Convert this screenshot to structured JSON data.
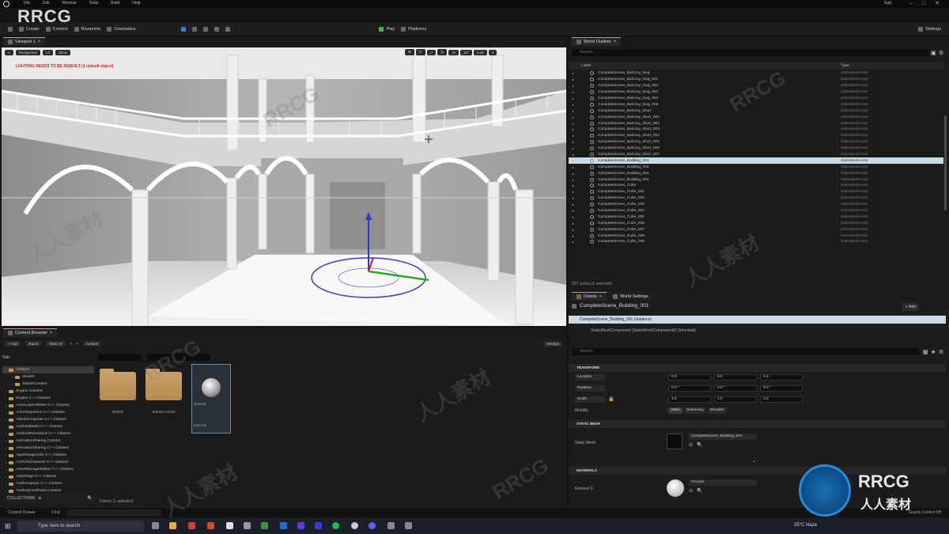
{
  "menu": {
    "items": [
      "File",
      "Edit",
      "Window",
      "Tools",
      "Build",
      "Help"
    ],
    "project": "Sad"
  },
  "watermark": {
    "top_left": "RRCG",
    "logo_main": "RRCG",
    "logo_sub": "人人素材",
    "diag_cn": "人人素材",
    "diag_en": "RRCG"
  },
  "toolbar": {
    "save": "",
    "mode": "Create",
    "content": "Content",
    "blueprints": "Blueprints",
    "cinematics": "Cinematics",
    "play": "Play",
    "platforms": "Platforms",
    "settings": "Settings"
  },
  "viewport": {
    "tab": "Viewport 1",
    "perspective": "Perspective",
    "lit": "Lit",
    "show": "Show",
    "warning": "LIGHTING NEEDS TO BE REBUILT (1 unbuilt object)",
    "icons": [
      "10",
      "10°",
      "0.25",
      "4"
    ]
  },
  "outliner": {
    "tab": "World Outliner",
    "search_placeholder": "Search...",
    "col_label": "Label",
    "col_type": "Type",
    "rows": [
      {
        "name": "CompleteScene_Balcony_long",
        "type": "StaticMeshActor"
      },
      {
        "name": "CompleteScene_Balcony_long_001",
        "type": "StaticMeshActor"
      },
      {
        "name": "CompleteScene_Balcony_long_002",
        "type": "StaticMeshActor"
      },
      {
        "name": "CompleteScene_Balcony_long_003",
        "type": "StaticMeshActor"
      },
      {
        "name": "CompleteScene_Balcony_long_004",
        "type": "StaticMeshActor"
      },
      {
        "name": "CompleteScene_Balcony_long_005",
        "type": "StaticMeshActor"
      },
      {
        "name": "CompleteScene_Balcony_short",
        "type": "StaticMeshActor"
      },
      {
        "name": "CompleteScene_Balcony_short_001",
        "type": "StaticMeshActor"
      },
      {
        "name": "CompleteScene_Balcony_short_002",
        "type": "StaticMeshActor"
      },
      {
        "name": "CompleteScene_Balcony_short_003",
        "type": "StaticMeshActor"
      },
      {
        "name": "CompleteScene_Balcony_short_004",
        "type": "StaticMeshActor"
      },
      {
        "name": "CompleteScene_Balcony_short_005",
        "type": "StaticMeshActor"
      },
      {
        "name": "CompleteScene_Balcony_short_006",
        "type": "StaticMeshActor"
      },
      {
        "name": "CompleteScene_Balcony_short_007",
        "type": "StaticMeshActor"
      },
      {
        "name": "CompleteScene_Building_001",
        "type": "StaticMeshActor",
        "selected": true
      },
      {
        "name": "CompleteScene_Building_002",
        "type": "StaticMeshActor"
      },
      {
        "name": "CompleteScene_Building_003",
        "type": "StaticMeshActor"
      },
      {
        "name": "CompleteScene_Building_004",
        "type": "StaticMeshActor"
      },
      {
        "name": "CompleteScene_Cube",
        "type": "StaticMeshActor"
      },
      {
        "name": "CompleteScene_Cube_001",
        "type": "StaticMeshActor"
      },
      {
        "name": "CompleteScene_Cube_002",
        "type": "StaticMeshActor"
      },
      {
        "name": "CompleteScene_Cube_003",
        "type": "StaticMeshActor"
      },
      {
        "name": "CompleteScene_Cube_004",
        "type": "StaticMeshActor"
      },
      {
        "name": "CompleteScene_Cube_005",
        "type": "StaticMeshActor"
      },
      {
        "name": "CompleteScene_Cube_006",
        "type": "StaticMeshActor"
      },
      {
        "name": "CompleteScene_Cube_007",
        "type": "StaticMeshActor"
      },
      {
        "name": "CompleteScene_Cube_008",
        "type": "StaticMeshActor"
      },
      {
        "name": "CompleteScene_Cube_009",
        "type": "StaticMeshActor"
      }
    ],
    "status": "157 actors (1 selected)"
  },
  "details": {
    "tab": "Details",
    "tab2": "World Settings",
    "object_name": "CompleteScene_Building_001",
    "add_label": "+ Add",
    "instance_row": "CompleteScene_Building_001 (Instance)",
    "component_row": "StaticMeshComponent (StaticMeshComponent0) (Inherited)",
    "search_placeholder": "Search",
    "transform_header": "TRANSFORM",
    "location_label": "Location",
    "rotation_label": "Rotation",
    "scale_label": "Scale",
    "location": [
      "0.0",
      "0.0",
      "0.0"
    ],
    "rotation": [
      "0.0 °",
      "0.0 °",
      "0.0 °"
    ],
    "scale": [
      "1.0",
      "1.0",
      "1.0"
    ],
    "mobility_label": "Mobility",
    "mobility": [
      "Static",
      "Stationary",
      "Movable"
    ],
    "static_mesh_header": "STATIC MESH",
    "static_mesh_label": "Static Mesh",
    "static_mesh_value": "CompleteScene_Building_001",
    "materials_header": "MATERIALS",
    "element_label": "Element 0",
    "material_value": "Ground"
  },
  "content_browser": {
    "tab": "Content Browser",
    "add": "+ Add",
    "import": "Import",
    "save_all": "Save All",
    "path": "Content",
    "settings": "Settings",
    "tree_header": "Sub",
    "tree": [
      {
        "label": "Content",
        "selected": true
      },
      {
        "label": "Models"
      },
      {
        "label": "StarterContent"
      },
      {
        "label": "Engine Content"
      },
      {
        "label": "Engine C++ Classes"
      },
      {
        "label": "ActorLayerUtilities C++ Classes"
      },
      {
        "label": "ActorSequence C++ Classes"
      },
      {
        "label": "AlembicImporter C++ Classes"
      },
      {
        "label": "AndroidMedia C++ Classes"
      },
      {
        "label": "AndroidPermission C++ Classes"
      },
      {
        "label": "AnimationSharing Content"
      },
      {
        "label": "AnimationSharing C++ Classes"
      },
      {
        "label": "AppleImageUtils C++ Classes"
      },
      {
        "label": "ArchVisCharacter C++ Classes"
      },
      {
        "label": "AssetManagerEditor C++ Classes"
      },
      {
        "label": "AssetTags C++ Classes"
      },
      {
        "label": "AudioCapture C++ Classes"
      },
      {
        "label": "AudioSynesthesia Content"
      }
    ],
    "collections": "COLLECTIONS",
    "assets": [
      {
        "label": "Models",
        "kind": "folder"
      },
      {
        "label": "StarterContent",
        "kind": "folder"
      },
      {
        "label": "Ground",
        "kind": "material",
        "sub": "Material"
      }
    ],
    "status": "3 items (1 selected)"
  },
  "statusbar": {
    "drawer": "Content Drawer",
    "cmd": "Cmd",
    "source": "Source Control Off"
  },
  "taskbar": {
    "search": "Type here to search",
    "weather": "25°C  Haze",
    "time": "",
    "date": ""
  }
}
